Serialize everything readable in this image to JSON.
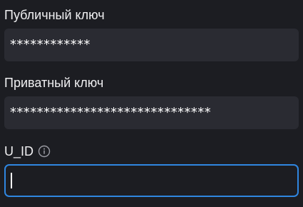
{
  "fields": [
    {
      "label": "Публичный ключ",
      "value": "************"
    },
    {
      "label": "Приватный ключ",
      "value": "******************************"
    },
    {
      "label": "U_ID",
      "value": "",
      "focused": true,
      "info_icon": "info-circle-icon"
    }
  ],
  "colors": {
    "background": "#1c1d22",
    "field_background": "#2a2b32",
    "focus_border": "#2f86e0",
    "text": "#f0f0f2"
  }
}
